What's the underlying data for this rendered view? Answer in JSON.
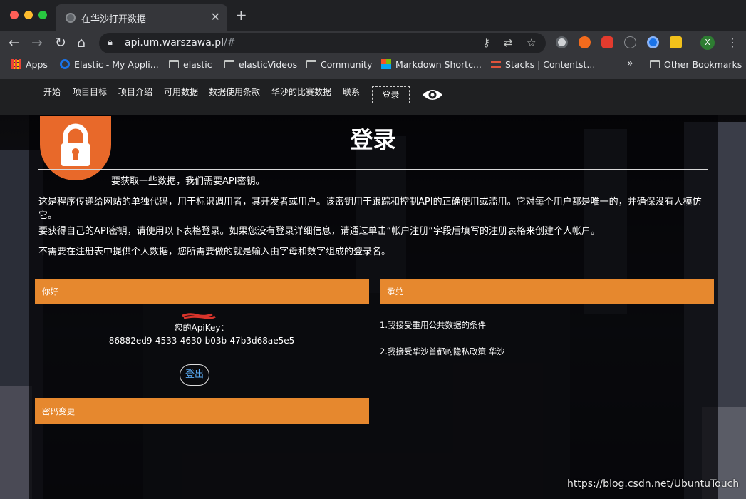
{
  "browser": {
    "tab_title": "在华沙打开数据",
    "url_host": "api.um.warszawa.pl",
    "url_rest": "/#",
    "profile_initial": "X",
    "bookmarks": [
      {
        "label": "Apps",
        "icon": "apps-grid-icon"
      },
      {
        "label": "Elastic - My Appli...",
        "icon": "elastic-icon"
      },
      {
        "label": "elastic",
        "icon": "folder-icon"
      },
      {
        "label": "elasticVideos",
        "icon": "folder-icon"
      },
      {
        "label": "Community",
        "icon": "folder-icon"
      },
      {
        "label": "Markdown Shortc...",
        "icon": "microsoft-icon"
      },
      {
        "label": "Stacks | Contentst...",
        "icon": "stacks-icon"
      }
    ],
    "bookmarks_overflow": "»",
    "other_bookmarks": "Other Bookmarks"
  },
  "nav": {
    "items": [
      "开始",
      "项目目标",
      "项目介绍",
      "可用数据",
      "数据使用条款",
      "华沙的比赛数据",
      "联系"
    ],
    "login_label": "登录"
  },
  "main": {
    "title": "登录",
    "intro_line1": "要获取一些数据，我们需要API密钥。",
    "intro_para1": "这是程序传递给网站的单独代码，用于标识调用者，其开发者或用户。该密钥用于跟踪和控制API的正确使用或滥用。它对每个用户都是唯一的，并确保没有人模仿它。",
    "intro_para2": "要获得自己的API密钥，请使用以下表格登录。如果您没有登录详细信息，请通过单击“帐户注册”字段后填写的注册表格来创建个人帐户。",
    "intro_para3": "不需要在注册表中提供个人数据，您所需要做的就是输入由字母和数字组成的登录名。"
  },
  "hello_panel": {
    "header": "你好",
    "apikey_label": "您的ApiKey：",
    "apikey_value": "86882ed9-4533-4630-b03b-47b3d68ae5e5",
    "logout_label": "登出"
  },
  "password_panel": {
    "header": "密码变更"
  },
  "accept_panel": {
    "header": "承兑",
    "items": [
      "1.我接受重用公共数据的条件",
      "2.我接受华沙首都的隐私政策 华沙"
    ]
  },
  "watermark": "https://blog.csdn.net/UbuntuTouch",
  "colors": {
    "accent_orange": "#e6882e",
    "lock_orange": "#e8692a",
    "link_blue": "#5aa9f0"
  }
}
